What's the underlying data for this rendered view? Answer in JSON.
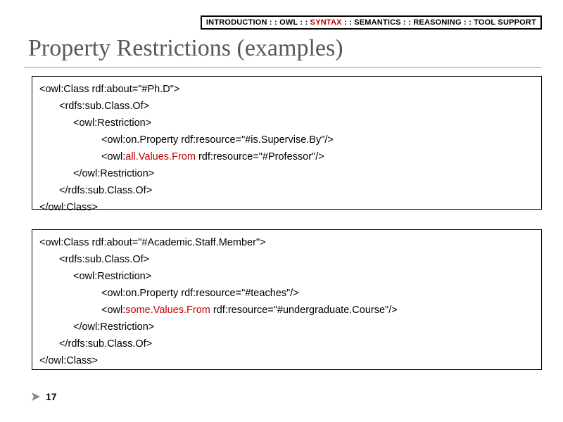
{
  "nav": {
    "items": [
      "INTRODUCTION",
      "OWL",
      "SYNTAX",
      "SEMANTICS",
      "REASONING",
      "TOOL SUPPORT"
    ],
    "sep": " : : ",
    "active_index": 2
  },
  "title": "Property Restrictions (examples)",
  "code1": {
    "l1a": "<owl:Class rdf:about=\"#Ph.D\">",
    "l2": "<rdfs:sub.Class.Of>",
    "l3": "<owl:Restriction>",
    "l4": "<owl:on.Property rdf:resource=\"#is.Supervise.By\"/>",
    "l5a": "<owl:",
    "l5kw": "all.Values.From",
    "l5b": " rdf:resource=\"#Professor\"/>",
    "l6": "</owl:Restriction>",
    "l7": "</rdfs:sub.Class.Of>",
    "l8": "</owl:Class>"
  },
  "code2": {
    "l1a": "<owl:Class rdf:about=\"#Academic.Staff.Member\">",
    "l2": "<rdfs:sub.Class.Of>",
    "l3": "<owl:Restriction>",
    "l4": "<owl:on.Property rdf:resource=\"#teaches\"/>",
    "l5a": "<owl:",
    "l5kw": "some.Values.From",
    "l5b": " rdf:resource=\"#undergraduate.Course\"/>",
    "l6": "</owl:Restriction>",
    "l7": "</rdfs:sub.Class.Of>",
    "l8": "</owl:Class>"
  },
  "page_number": "17"
}
